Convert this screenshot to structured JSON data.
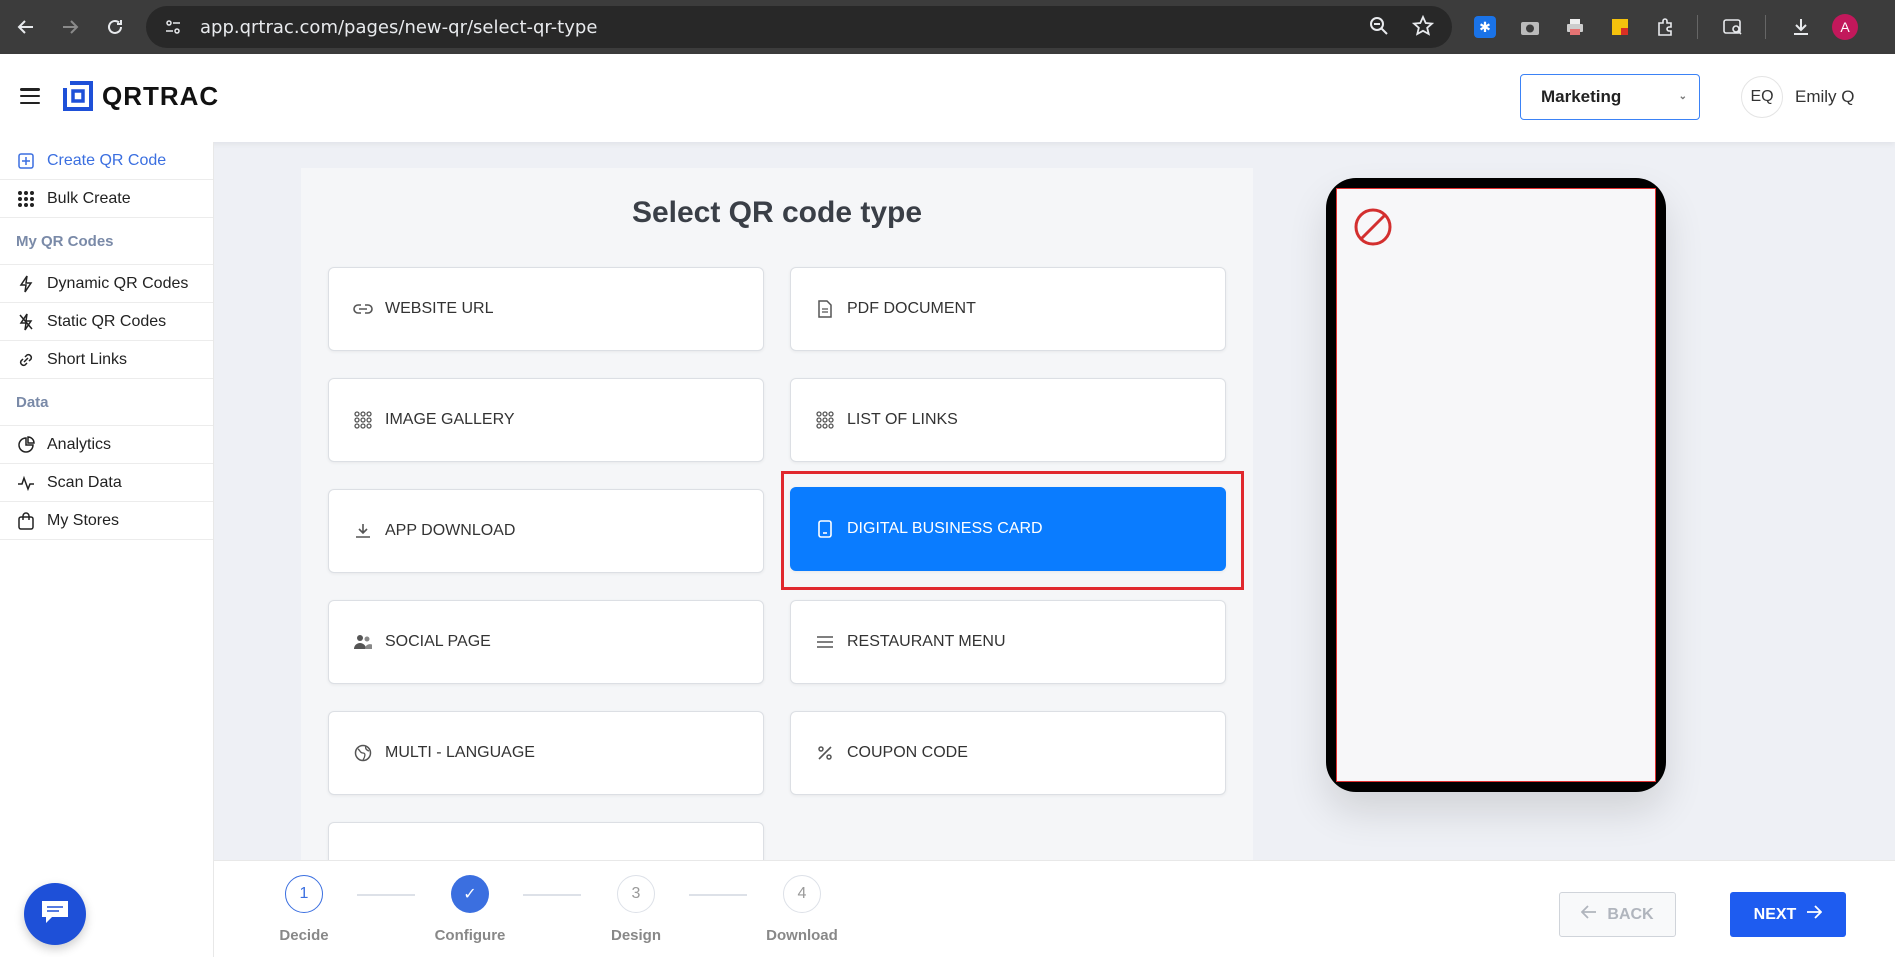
{
  "browser": {
    "url": "app.qrtrac.com/pages/new-qr/select-qr-type",
    "profile_initial": "A"
  },
  "header": {
    "logo_text": "QRTRAC",
    "team_select": "Marketing",
    "user_initials": "EQ",
    "user_name": "Emily Q"
  },
  "sidebar": {
    "create": "Create QR Code",
    "bulk": "Bulk Create",
    "section_my_codes": "My QR Codes",
    "dynamic": "Dynamic QR Codes",
    "static": "Static QR Codes",
    "short_links": "Short Links",
    "section_data": "Data",
    "analytics": "Analytics",
    "scan_data": "Scan Data",
    "stores": "My Stores"
  },
  "main": {
    "title": "Select QR code type",
    "types": {
      "website_url": "WEBSITE URL",
      "pdf_document": "PDF DOCUMENT",
      "image_gallery": "IMAGE GALLERY",
      "list_of_links": "LIST OF LINKS",
      "app_download": "APP DOWNLOAD",
      "digital_business_card": "DIGITAL BUSINESS CARD",
      "social_page": "SOCIAL PAGE",
      "restaurant_menu": "RESTAURANT MENU",
      "multi_language": "MULTI - LANGUAGE",
      "coupon_code": "COUPON CODE"
    },
    "selected_type": "DIGITAL BUSINESS CARD"
  },
  "stepper": {
    "steps": [
      {
        "number": "1",
        "label": "Decide",
        "state": "current"
      },
      {
        "number": "✓",
        "label": "Configure",
        "state": "done"
      },
      {
        "number": "3",
        "label": "Design",
        "state": "todo"
      },
      {
        "number": "4",
        "label": "Download",
        "state": "todo"
      }
    ],
    "back_label": "BACK",
    "next_label": "NEXT"
  },
  "colors": {
    "accent": "#1e5cf0",
    "selected_card": "#0a7cff",
    "highlight_border": "#e0282e"
  }
}
